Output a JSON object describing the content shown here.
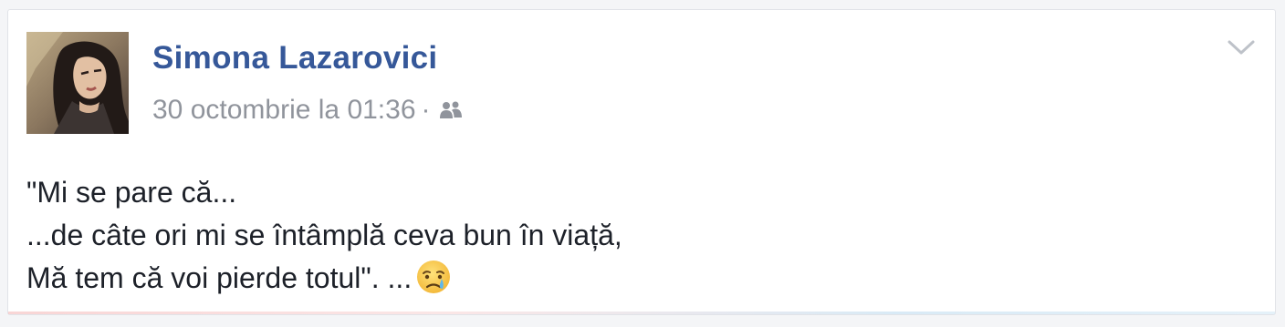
{
  "post": {
    "author_name": "Simona Lazarovici",
    "timestamp": "30 octombrie la 01:36",
    "separator": "·",
    "audience_icon": "friends-icon",
    "options_icon": "chevron-down-icon",
    "body_lines": [
      "\"Mi se pare că...",
      "...de câte ori mi se întâmplă ceva bun în viață,",
      "Mă tem că voi pierde totul\". ..."
    ],
    "emoji": "crying-face-emoji"
  },
  "colors": {
    "author_link": "#365899",
    "meta_text": "#90949c",
    "body_text": "#1d2129",
    "card_bg": "#ffffff",
    "page_bg": "#f4f5f7"
  }
}
